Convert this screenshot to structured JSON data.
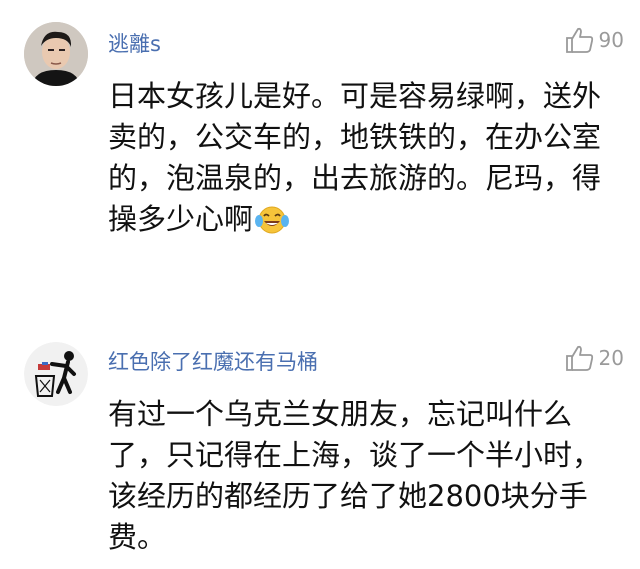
{
  "comments": [
    {
      "username": "逃離s",
      "likes": "90",
      "avatar_icon": "user-photo-avatar",
      "lines": [
        "日本女孩儿是好。可是容易绿啊，送外",
        "卖的，公交车的，地铁铁的，在办公室",
        "的，泡温泉的，出去旅游的。尼玛，得",
        "操多少心啊"
      ],
      "emoji": "crying-laughing-emoji"
    },
    {
      "username": "红色除了红魔还有马桶",
      "likes": "20",
      "avatar_icon": "trash-throw-avatar",
      "lines": [
        "有过一个乌克兰女朋友，忘记叫什么",
        "了，只记得在上海，谈了一个半小时，",
        "该经历的都经历了给了她2800块分手",
        "费。"
      ]
    }
  ],
  "colors": {
    "username": "#4a6fb0",
    "text": "#111111",
    "like": "#9a9a9a"
  }
}
